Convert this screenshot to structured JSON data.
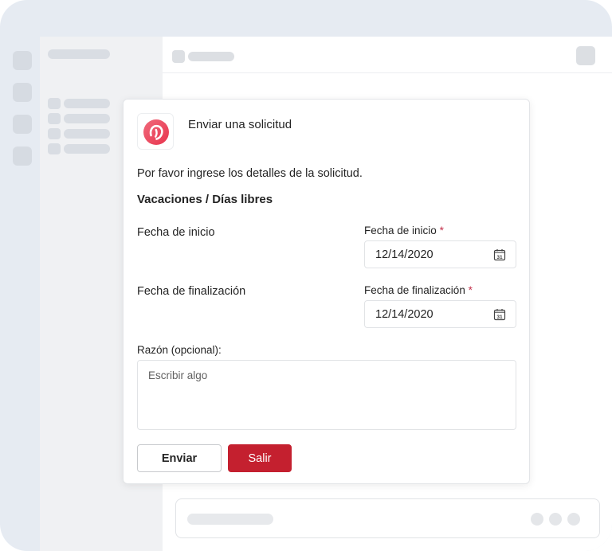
{
  "dialog": {
    "title": "Enviar una solicitud",
    "intro": "Por favor ingrese los detalles de la solicitud.",
    "section_title": "Vacaciones / Días libres",
    "start": {
      "row_label": "Fecha de inicio",
      "field_label": "Fecha de inicio",
      "required_mark": "*",
      "value": "12/14/2020"
    },
    "end": {
      "row_label": "Fecha de finalización",
      "field_label": "Fecha de finalización",
      "required_mark": "*",
      "value": "12/14/2020"
    },
    "reason": {
      "label": "Razón (opcional):",
      "placeholder": "Escribir algo"
    },
    "buttons": {
      "send": "Enviar",
      "exit": "Salir"
    },
    "calendar_icon_text": "31"
  },
  "icons": {
    "app_logo": "app-logo-icon",
    "calendar": "calendar-icon"
  },
  "colors": {
    "accent": "#c4202f",
    "required": "#c4314b",
    "logo_gradient_start": "#f06a7b",
    "logo_gradient_end": "#e8344e"
  }
}
